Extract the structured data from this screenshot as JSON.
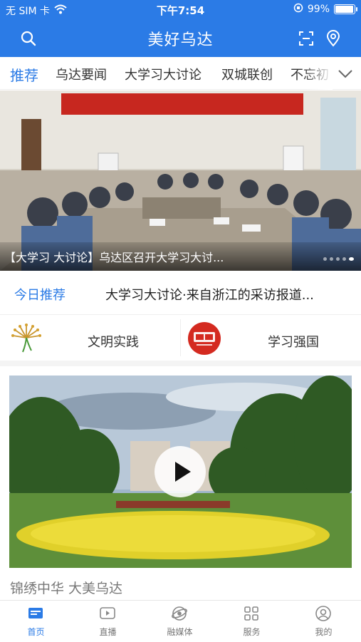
{
  "status_bar": {
    "carrier": "无 SIM 卡",
    "time": "下午7:54",
    "battery": "99%",
    "battery_level": 0.99
  },
  "header": {
    "title": "美好乌达"
  },
  "tabs": [
    {
      "label": "推荐",
      "active": true
    },
    {
      "label": "乌达要闻",
      "active": false
    },
    {
      "label": "大学习大讨论",
      "active": false
    },
    {
      "label": "双城联创",
      "active": false
    },
    {
      "label": "不忘初",
      "active": false
    }
  ],
  "banner": {
    "caption": "【大学习 大讨论】乌达区召开大学习大讨...",
    "slide_count": 5,
    "active_slide": 4
  },
  "today": {
    "label": "今日推荐",
    "headline": "大学习大讨论·来自浙江的采访报道..."
  },
  "shortcuts": [
    {
      "label": "文明实践"
    },
    {
      "label": "学习强国"
    }
  ],
  "video": {
    "title": "锦绣中华 大美乌达"
  },
  "bottom_nav": [
    {
      "label": "首页",
      "icon": "home-icon",
      "active": true
    },
    {
      "label": "直播",
      "icon": "live-icon",
      "active": false
    },
    {
      "label": "融媒体",
      "icon": "media-icon",
      "active": false
    },
    {
      "label": "服务",
      "icon": "services-grid-icon",
      "active": false
    },
    {
      "label": "我的",
      "icon": "profile-icon",
      "active": false
    }
  ],
  "colors": {
    "brand": "#2b7be6",
    "inactive_text": "#777777"
  }
}
